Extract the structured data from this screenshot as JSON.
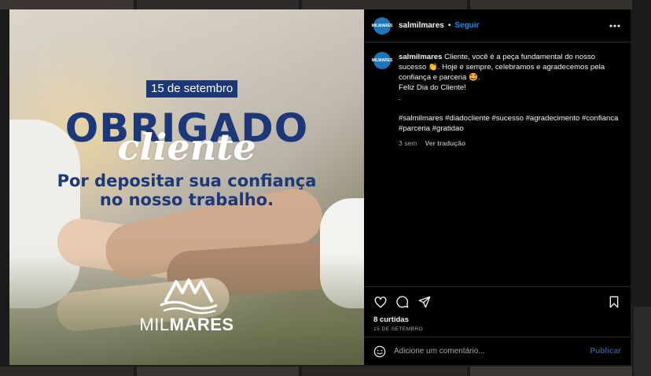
{
  "post": {
    "date_badge": "15 de setembro",
    "headline": "OBRIGADO",
    "headline_script": "cliente",
    "tagline_line1": "Por depositar sua confiança",
    "tagline_line2": "no nosso trabalho.",
    "brand_light": "MIL",
    "brand_bold": "MARES"
  },
  "header": {
    "avatar_text": "MILMARES",
    "username": "salmilmares",
    "separator": "•",
    "follow_label": "Seguir"
  },
  "caption": {
    "username": "salmilmares",
    "line1": " Cliente, você é a peça fundamental do nosso sucesso 👏. Hoje e sempre, celebramos e agradecemos pela confiança e parceria 🤩.",
    "line2": "Feliz Dia do Cliente!",
    "line3": ".",
    "hashtags": "#salmilmares #diadocliente #sucesso #agradecimento #confianca #parceria #gratidao",
    "age": "3 sem",
    "translate_label": "Ver tradução"
  },
  "actions": {
    "likes": "8 curtidas",
    "date": "15 DE SETEMBRO"
  },
  "comment": {
    "placeholder": "Adicione um comentário...",
    "publish_label": "Publicar"
  },
  "colors": {
    "brand_navy": "#1d3878",
    "link_blue": "#0095f6"
  }
}
